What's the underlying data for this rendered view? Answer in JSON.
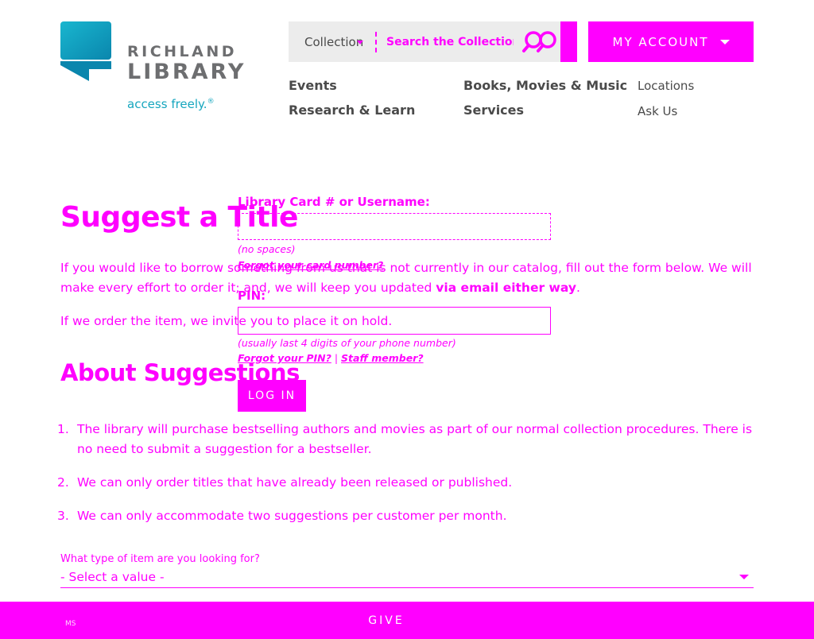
{
  "brand": {
    "name_line1": "RICHLAND",
    "name_line2": "LIBRARY",
    "tagline": "access freely.",
    "tagline_mark": "®",
    "colors": {
      "teal": "#16a6be",
      "gray": "#6d6e70",
      "accent": "#ff00ff"
    }
  },
  "search": {
    "scope_label": "Collection",
    "placeholder": "Search the Collection",
    "icon": "search-icon"
  },
  "account": {
    "label": "MY ACCOUNT",
    "icon": "caret-down-icon"
  },
  "nav": {
    "events": "Events",
    "books": "Books, Movies & Music",
    "locations": "Locations",
    "research": "Research & Learn",
    "services": "Services",
    "ask": "Ask Us"
  },
  "main": {
    "title": "Suggest a Title",
    "intro_text": "If you would like to borrow something from us that is not currently in our catalog, fill out the form below. We will make every effort to order it; and, we will keep you updated ",
    "intro_strong": "via email either way",
    "intro_end": ".",
    "intro2": "If we order the item, we invite you to place it on hold.",
    "section_title": "About Suggestions",
    "rules": [
      {
        "num": "1.",
        "text": "The library will purchase bestselling authors and movies as part of our normal collection procedures. There is no need to submit a suggestion for a bestseller."
      },
      {
        "num": "2.",
        "text": "We can only order titles that have already been released or published."
      },
      {
        "num": "3.",
        "text": "We can only accommodate two suggestions per customer per month."
      }
    ],
    "type_question": "What type of item are you looking for?",
    "type_selected": "- Select a value -"
  },
  "login": {
    "card_label": "Library Card # or Username:",
    "card_hint": "(no spaces)",
    "forgot_card": "Forgot your card number?",
    "pin_label": "PIN:",
    "pin_hint": "(usually last 4 digits of your phone number)",
    "forgot_pin": "Forgot your PIN?",
    "separator": "|",
    "staff": "Staff member?",
    "button": "LOG IN"
  },
  "footer": {
    "small": "MS",
    "give": "GIVE"
  }
}
